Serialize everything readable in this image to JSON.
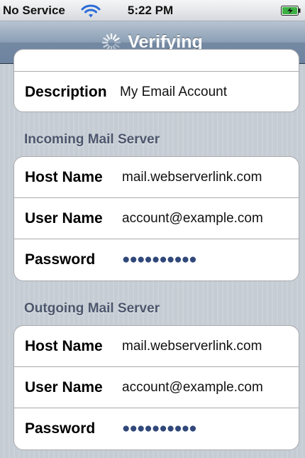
{
  "status_bar": {
    "carrier": "No Service",
    "time": "5:22 PM",
    "wifi_icon": "wifi-icon",
    "battery_icon": "battery-charging-icon"
  },
  "nav_bar": {
    "title": "Verifying",
    "activity_icon": "spinner-icon"
  },
  "account": {
    "description_label": "Description",
    "description_value": "My Email Account"
  },
  "incoming": {
    "header": "Incoming Mail Server",
    "host_label": "Host Name",
    "host_value": "mail.webserverlink.com",
    "user_label": "User Name",
    "user_value": "account@example.com",
    "password_label": "Password",
    "password_value": "●●●●●●●●●●"
  },
  "outgoing": {
    "header": "Outgoing Mail Server",
    "host_label": "Host Name",
    "host_value": "mail.webserverlink.com",
    "user_label": "User Name",
    "user_value": "account@example.com",
    "password_label": "Password",
    "password_value": "●●●●●●●●●●"
  },
  "colors": {
    "nav_bar": "#7489a2",
    "section_header": "#4c566c",
    "password_dots": "#30487a",
    "background": "#c5ccd4"
  }
}
